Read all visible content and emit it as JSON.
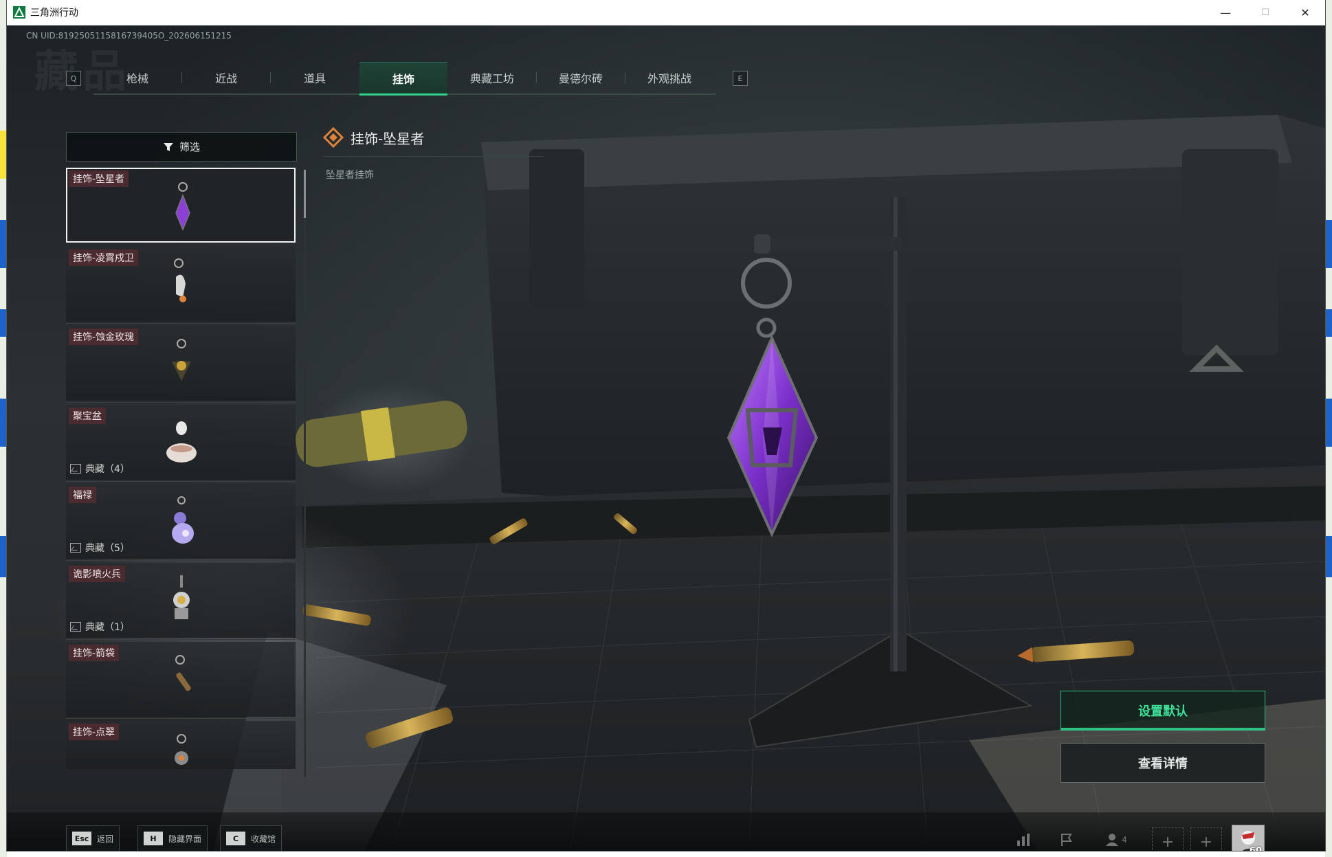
{
  "window": {
    "title": "三角洲行动",
    "controls": {
      "minimize": "—",
      "maximize": "☐",
      "close": "✕"
    }
  },
  "uid": "CN UID:8192505115816739405O_202606151215",
  "ghost_title": "藏品",
  "tabs": {
    "left_key": "Q",
    "right_key": "E",
    "items": [
      {
        "label": "枪械",
        "active": false
      },
      {
        "label": "近战",
        "active": false
      },
      {
        "label": "道具",
        "active": false
      },
      {
        "label": "挂饰",
        "active": true
      },
      {
        "label": "典藏工坊",
        "active": false
      },
      {
        "label": "曼德尔砖",
        "active": false
      },
      {
        "label": "外观挑战",
        "active": false
      }
    ]
  },
  "filter": {
    "label": "筛选",
    "icon": "filter-icon"
  },
  "items": [
    {
      "name": "挂饰-坠星者",
      "badge": "",
      "selected": true
    },
    {
      "name": "挂饰-凌霄戍卫",
      "badge": "",
      "selected": false
    },
    {
      "name": "挂饰-蚀金玫瑰",
      "badge": "",
      "selected": false
    },
    {
      "name": "聚宝盆",
      "badge": "典藏（4）",
      "selected": false
    },
    {
      "name": "福禄",
      "badge": "典藏（5）",
      "selected": false
    },
    {
      "name": "诡影喷火兵",
      "badge": "典藏（1）",
      "selected": false
    },
    {
      "name": "挂饰-箭袋",
      "badge": "",
      "selected": false
    },
    {
      "name": "挂饰-点翠",
      "badge": "",
      "selected": false
    }
  ],
  "detail": {
    "title": "挂饰-坠星者",
    "subtitle": "坠星者挂饰",
    "accent": "#e0833a"
  },
  "actions": {
    "set_default": "设置默认",
    "view_details": "查看详情"
  },
  "bottom": {
    "hotkeys": [
      {
        "key": "Esc",
        "label": "返回"
      },
      {
        "key": "H",
        "label": "隐藏界面"
      },
      {
        "key": "C",
        "label": "收藏馆"
      }
    ],
    "friend_count": "4",
    "avatar_level": "60"
  },
  "colors": {
    "accent_green": "#2fd38b",
    "item_tag_bg": "#4a2b30",
    "gem_purple": "#8b3fd6"
  }
}
